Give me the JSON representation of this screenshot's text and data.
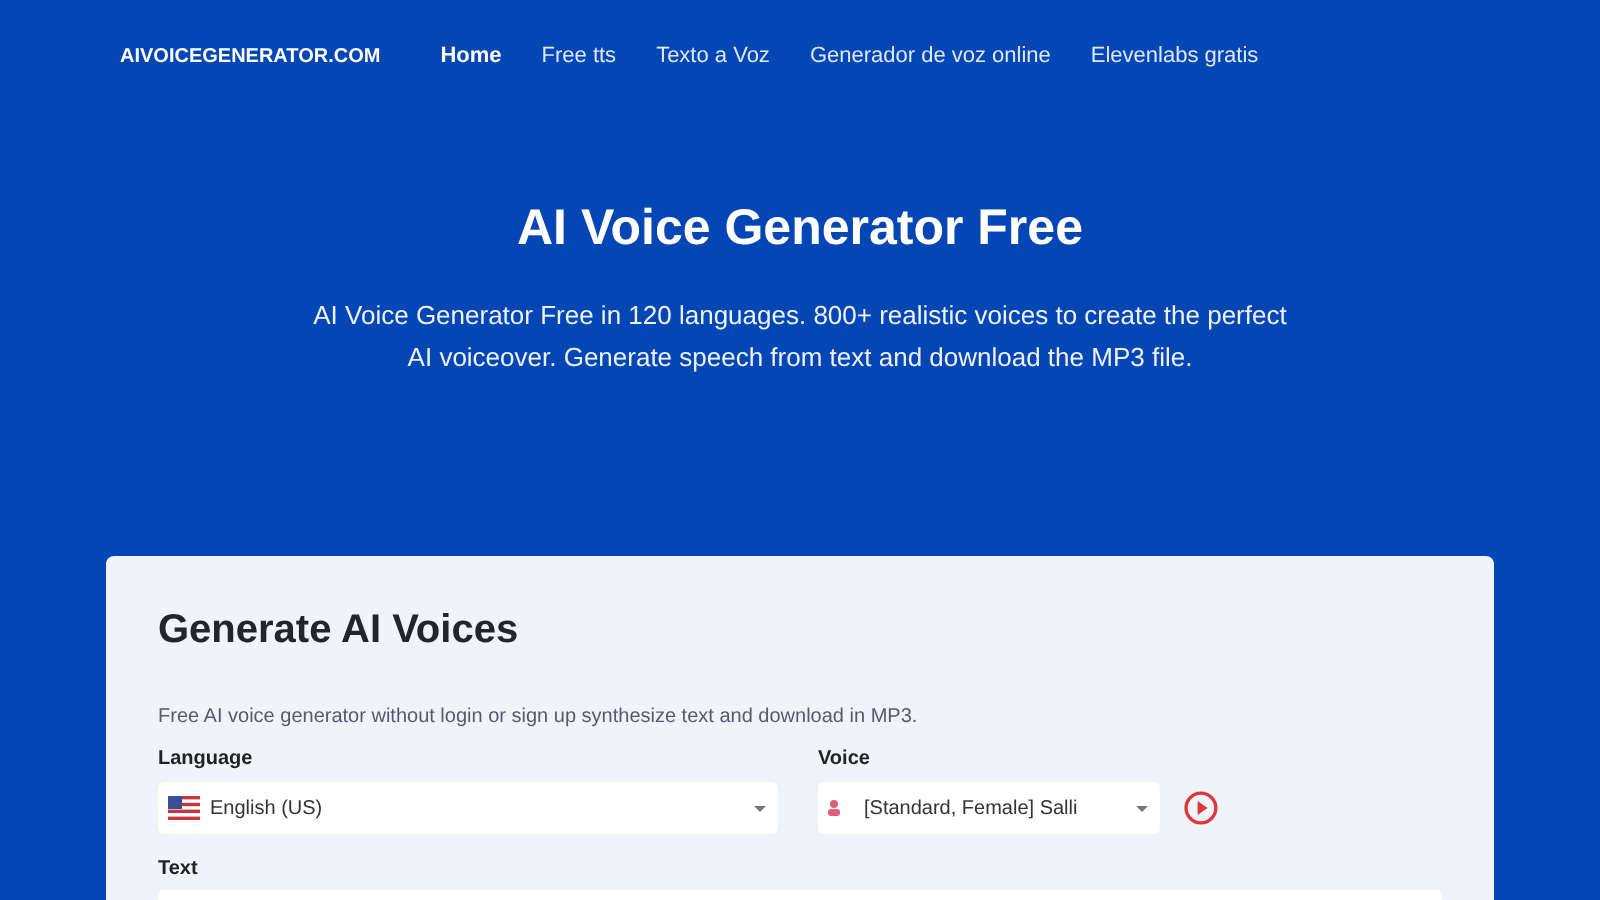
{
  "nav": {
    "logo": "AIVOICEGENERATOR.COM",
    "items": [
      {
        "label": "Home",
        "selected": true
      },
      {
        "label": "Free tts",
        "selected": false
      },
      {
        "label": "Texto a Voz",
        "selected": false
      },
      {
        "label": "Generador de voz online",
        "selected": false
      },
      {
        "label": "Elevenlabs gratis",
        "selected": false
      }
    ]
  },
  "hero": {
    "title": "AI Voice Generator Free",
    "subtitle": "AI Voice Generator Free in 120 languages. 800+ realistic voices to create the perfect AI voiceover. Generate speech from text and download the MP3 file."
  },
  "card": {
    "title": "Generate AI Voices",
    "description": "Free AI voice generator without login or sign up synthesize text and download in MP3.",
    "language": {
      "label": "Language",
      "value": "English (US)"
    },
    "voice": {
      "label": "Voice",
      "value": "[Standard, Female] Salli"
    },
    "text_label": "Text"
  }
}
